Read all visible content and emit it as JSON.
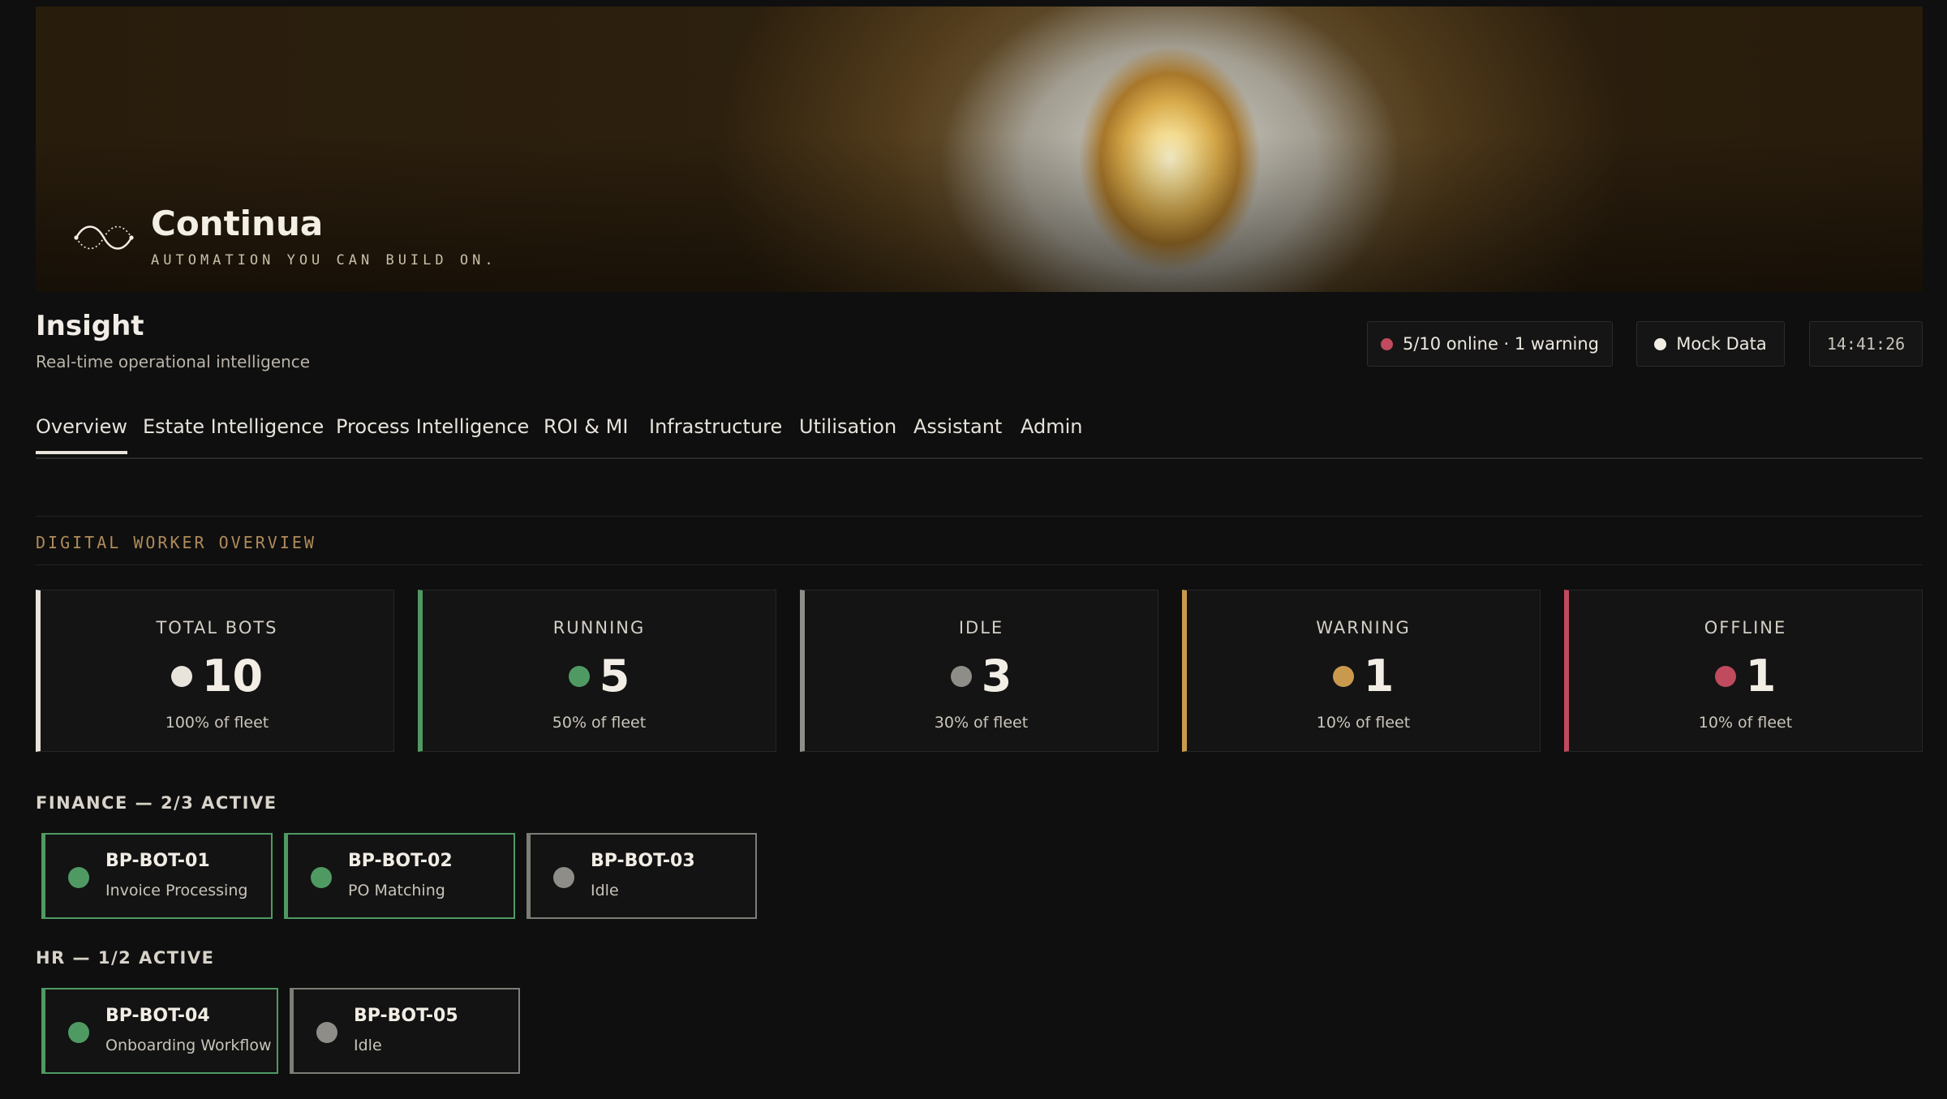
{
  "brand": {
    "name": "Continua",
    "tagline": "AUTOMATION YOU CAN BUILD ON."
  },
  "header": {
    "title": "Insight",
    "subtitle": "Real-time operational intelligence",
    "status_pill": "5/10 online · 1 warning",
    "data_mode": "Mock Data",
    "clock": "14:41:26"
  },
  "tabs": [
    {
      "label": "Overview",
      "active": true
    },
    {
      "label": "Estate Intelligence"
    },
    {
      "label": "Process Intelligence"
    },
    {
      "label": "ROI & MI"
    },
    {
      "label": "Infrastructure"
    },
    {
      "label": "Utilisation"
    },
    {
      "label": "Assistant"
    },
    {
      "label": "Admin"
    }
  ],
  "overview": {
    "section_title": "DIGITAL WORKER OVERVIEW",
    "stats": [
      {
        "label": "TOTAL BOTS",
        "value": "10",
        "sub": "100% of fleet",
        "color": "#e8e4dc"
      },
      {
        "label": "RUNNING",
        "value": "5",
        "sub": "50% of fleet",
        "color": "#4f9a63"
      },
      {
        "label": "IDLE",
        "value": "3",
        "sub": "30% of fleet",
        "color": "#8f8d88"
      },
      {
        "label": "WARNING",
        "value": "1",
        "sub": "10% of fleet",
        "color": "#c99a4e"
      },
      {
        "label": "OFFLINE",
        "value": "1",
        "sub": "10% of fleet",
        "color": "#c04a5e"
      }
    ]
  },
  "groups": [
    {
      "title": "FINANCE — 2/3 ACTIVE",
      "bots": [
        {
          "name": "BP-BOT-01",
          "task": "Invoice Processing",
          "state": "running"
        },
        {
          "name": "BP-BOT-02",
          "task": "PO Matching",
          "state": "running"
        },
        {
          "name": "BP-BOT-03",
          "task": "Idle",
          "state": "idle"
        }
      ]
    },
    {
      "title": "HR — 1/2 ACTIVE",
      "bots": [
        {
          "name": "BP-BOT-04",
          "task": "Onboarding Workflow",
          "state": "running"
        },
        {
          "name": "BP-BOT-05",
          "task": "Idle",
          "state": "idle"
        }
      ]
    }
  ],
  "colors": {
    "online_dot": "#c04a5e",
    "mock_dot": "#f2eee6",
    "running": "#4f9a63",
    "idle": "#8f8d88",
    "accent": "#b08b5a"
  },
  "icons": {
    "brand_logo": "infinity-wave-icon",
    "status_dot": "dot-icon"
  }
}
